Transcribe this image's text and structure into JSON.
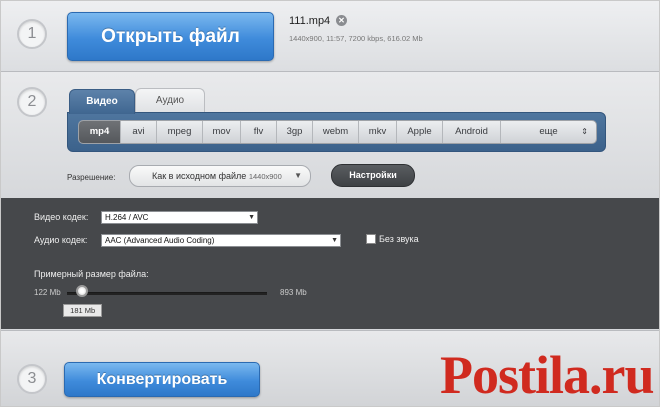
{
  "step1": {
    "number": "1",
    "open_label": "Открыть файл",
    "file_name": "111.mp4",
    "file_meta": "1440x900, 11:57, 7200 kbps, 616.02 Mb"
  },
  "step2": {
    "number": "2",
    "tabs": [
      {
        "label": "Видео",
        "active": true
      },
      {
        "label": "Аудио",
        "active": false
      }
    ],
    "formats": [
      {
        "label": "mp4",
        "selected": true
      },
      {
        "label": "avi"
      },
      {
        "label": "mpeg"
      },
      {
        "label": "mov"
      },
      {
        "label": "flv"
      },
      {
        "label": "3gp"
      },
      {
        "label": "webm"
      },
      {
        "label": "mkv"
      },
      {
        "label": "Apple"
      },
      {
        "label": "Android"
      },
      {
        "label": "еще"
      }
    ],
    "resolution_label": "Разрешение:",
    "resolution_value": "Как в исходном файле",
    "resolution_size": "1440x900",
    "settings_label": "Настройки"
  },
  "codec": {
    "video_label": "Видео кодек:",
    "video_value": "H.264 / AVC",
    "audio_label": "Аудио кодек:",
    "audio_value": "AAC (Advanced Audio Coding)",
    "no_sound_label": "Без звука",
    "size_label": "Примерный размер файла:",
    "size_min": "122 Mb",
    "size_max": "893 Mb",
    "size_current": "181 Mb",
    "size_fraction": 0.076
  },
  "step3": {
    "number": "3",
    "convert_label": "Конвертировать"
  },
  "watermark": {
    "text": "Postila.ru",
    "color": "#d02a1f"
  },
  "colors": {
    "accent_blue": "#3f8bdb",
    "panel_blue": "#3c628b",
    "dark_panel": "#46484b"
  }
}
